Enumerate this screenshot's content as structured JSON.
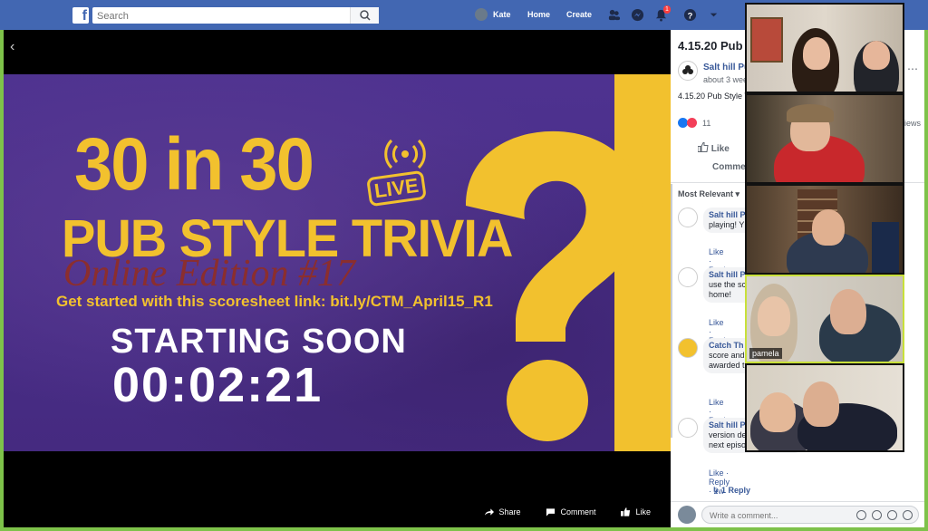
{
  "topbar": {
    "search_placeholder": "Search",
    "user_name": "Kate",
    "home_label": "Home",
    "create_label": "Create",
    "notification_count": "1",
    "brand_color": "#4267b2"
  },
  "video": {
    "headline": "30 in 30",
    "live_label": "LIVE",
    "subtitle": "PUB STYLE TRIVIA",
    "edition": "Online Edition #17",
    "scoresheet": "Get started with this scoresheet link: bit.ly/CTM_April15_R1",
    "starting": "STARTING SOON",
    "timer": "00:02:21",
    "actions": {
      "share": "Share",
      "comment": "Comment",
      "like": "Like"
    }
  },
  "sidebar": {
    "title": "4.15.20 Pub",
    "page_name": "Salt hill Pu",
    "posted": "about 3 wee",
    "description": "4.15.20 Pub Style T",
    "reaction_count": "11",
    "views_label": "iews",
    "like_label": "Like",
    "comment_label": "Commen",
    "sort_label": "Most Relevant ▾",
    "comments": [
      {
        "name": "Salt hill P",
        "text": "playing! Y work with",
        "actions": "Like · Repl"
      },
      {
        "name": "Salt hill P",
        "text": "use the sc paper and at home!",
        "actions": "Like · Repl"
      },
      {
        "name": "Catch Th",
        "text": "score and comment awarded this Salt h",
        "actions": "Like · Repl"
      },
      {
        "name": "Salt hill P",
        "text": "version de communi next episode!",
        "actions": "Like · Reply · 2w"
      }
    ],
    "reply_link": "↳ 1 Reply",
    "compose_placeholder": "Write a comment..."
  },
  "zoom": {
    "tiles": [
      {
        "label": ""
      },
      {
        "label": ""
      },
      {
        "label": ""
      },
      {
        "label": "pamela"
      },
      {
        "label": ""
      }
    ]
  }
}
